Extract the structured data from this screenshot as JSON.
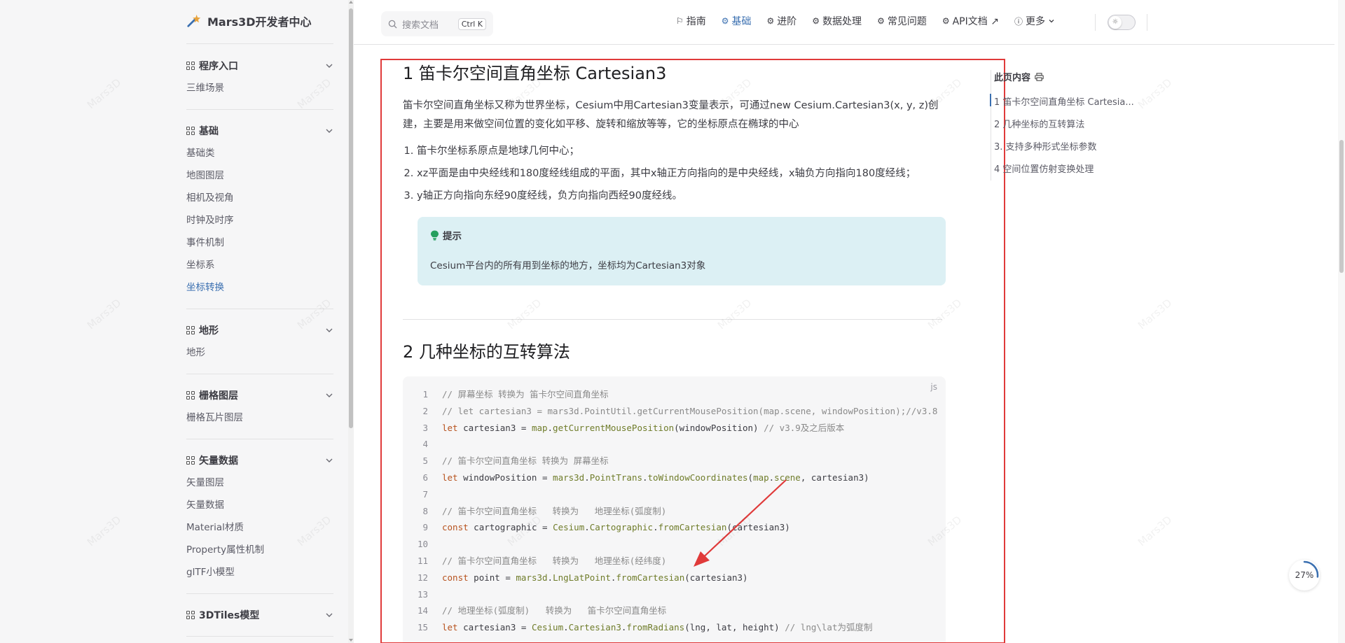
{
  "sidebar": {
    "brand": "Mars3D开发者中心",
    "groups": [
      {
        "title": "程序入口",
        "items": [
          {
            "label": "三维场景"
          }
        ]
      },
      {
        "title": "基础",
        "items": [
          {
            "label": "基础类"
          },
          {
            "label": "地图图层"
          },
          {
            "label": "相机及视角"
          },
          {
            "label": "时钟及时序"
          },
          {
            "label": "事件机制"
          },
          {
            "label": "坐标系"
          },
          {
            "label": "坐标转换",
            "active": true
          }
        ]
      },
      {
        "title": "地形",
        "items": [
          {
            "label": "地形"
          }
        ]
      },
      {
        "title": "栅格图层",
        "items": [
          {
            "label": "栅格瓦片图层"
          }
        ]
      },
      {
        "title": "矢量数据",
        "items": [
          {
            "label": "矢量图层"
          },
          {
            "label": "矢量数据"
          },
          {
            "label": "Material材质"
          },
          {
            "label": "Property属性机制"
          },
          {
            "label": "glTF小模型"
          }
        ]
      },
      {
        "title": "3DTiles模型",
        "items": []
      }
    ]
  },
  "topbar": {
    "search_placeholder": "搜索文档",
    "search_shortcut": "Ctrl K",
    "menu": [
      {
        "label": "指南",
        "icon": "guide-icon"
      },
      {
        "label": "基础",
        "icon": "basic-icon",
        "active": true
      },
      {
        "label": "进阶",
        "icon": "advanced-icon"
      },
      {
        "label": "数据处理",
        "icon": "data-icon"
      },
      {
        "label": "常见问题",
        "icon": "faq-icon"
      },
      {
        "label": "API文档 ↗",
        "icon": "api-icon"
      },
      {
        "label": "更多",
        "icon": "info-icon"
      }
    ]
  },
  "main": {
    "h1": "1 笛卡尔空间直角坐标 Cartesian3",
    "lead": "笛卡尔空间直角坐标又称为世界坐标，Cesium中用Cartesian3变量表示，可通过new Cesium.Cartesian3(x, y, z)创建，主要是用来做空间位置的变化如平移、旋转和缩放等等，它的坐标原点在椭球的中心",
    "list": [
      "笛卡尔坐标系原点是地球几何中心；",
      "xz平面是由中央经线和180度经线组成的平面，其中x轴正方向指向的是中央经线，x轴负方向指向180度经线；",
      "y轴正方向指向东经90度经线，负方向指向西经90度经线。"
    ],
    "tip_title": "提示",
    "tip_body": "Cesium平台内的所有用到坐标的地方，坐标均为Cartesian3对象",
    "h2": "2 几种坐标的互转算法",
    "code_lang": "js",
    "code_lines": [
      {
        "n": "1",
        "t": "// 屏幕坐标 转换为 笛卡尔空间直角坐标"
      },
      {
        "n": "2",
        "t": "// let cartesian3 = mars3d.PointUtil.getCurrentMousePosition(map.scene, windowPosition);//v3.8"
      },
      {
        "n": "3",
        "t": "let cartesian3 = map.getCurrentMousePosition(windowPosition) // v3.9及之后版本"
      },
      {
        "n": "4",
        "t": ""
      },
      {
        "n": "5",
        "t": "// 笛卡尔空间直角坐标 转换为 屏幕坐标"
      },
      {
        "n": "6",
        "t": "let windowPosition = mars3d.PointTrans.toWindowCoordinates(map.scene, cartesian3)"
      },
      {
        "n": "7",
        "t": ""
      },
      {
        "n": "8",
        "t": "// 笛卡尔空间直角坐标   转换为   地理坐标(弧度制)"
      },
      {
        "n": "9",
        "t": "const cartographic = Cesium.Cartographic.fromCartesian(cartesian3)"
      },
      {
        "n": "10",
        "t": ""
      },
      {
        "n": "11",
        "t": "// 笛卡尔空间直角坐标   转换为   地理坐标(经纬度)"
      },
      {
        "n": "12",
        "t": "const point = mars3d.LngLatPoint.fromCartesian(cartesian3)"
      },
      {
        "n": "13",
        "t": ""
      },
      {
        "n": "14",
        "t": "// 地理坐标(弧度制)   转换为   笛卡尔空间直角坐标"
      },
      {
        "n": "15",
        "t": "let cartesian3 = Cesium.Cartesian3.fromRadians(lng, lat, height) // lng\\lat为弧度制"
      }
    ]
  },
  "toc": {
    "title": "此页内容",
    "items": [
      "1 笛卡尔空间直角坐标 Cartesia...",
      "2 几种坐标的互转算法",
      "3. 支持多种形式坐标参数",
      "4 空间位置仿射变换处理"
    ]
  },
  "progress": {
    "label": "27%",
    "value": 0.27
  },
  "watermark": "Mars3D",
  "colors": {
    "accent": "#3a6fb0",
    "annotation_red": "#e03a3a",
    "tip_bg": "#dcf0f4"
  }
}
